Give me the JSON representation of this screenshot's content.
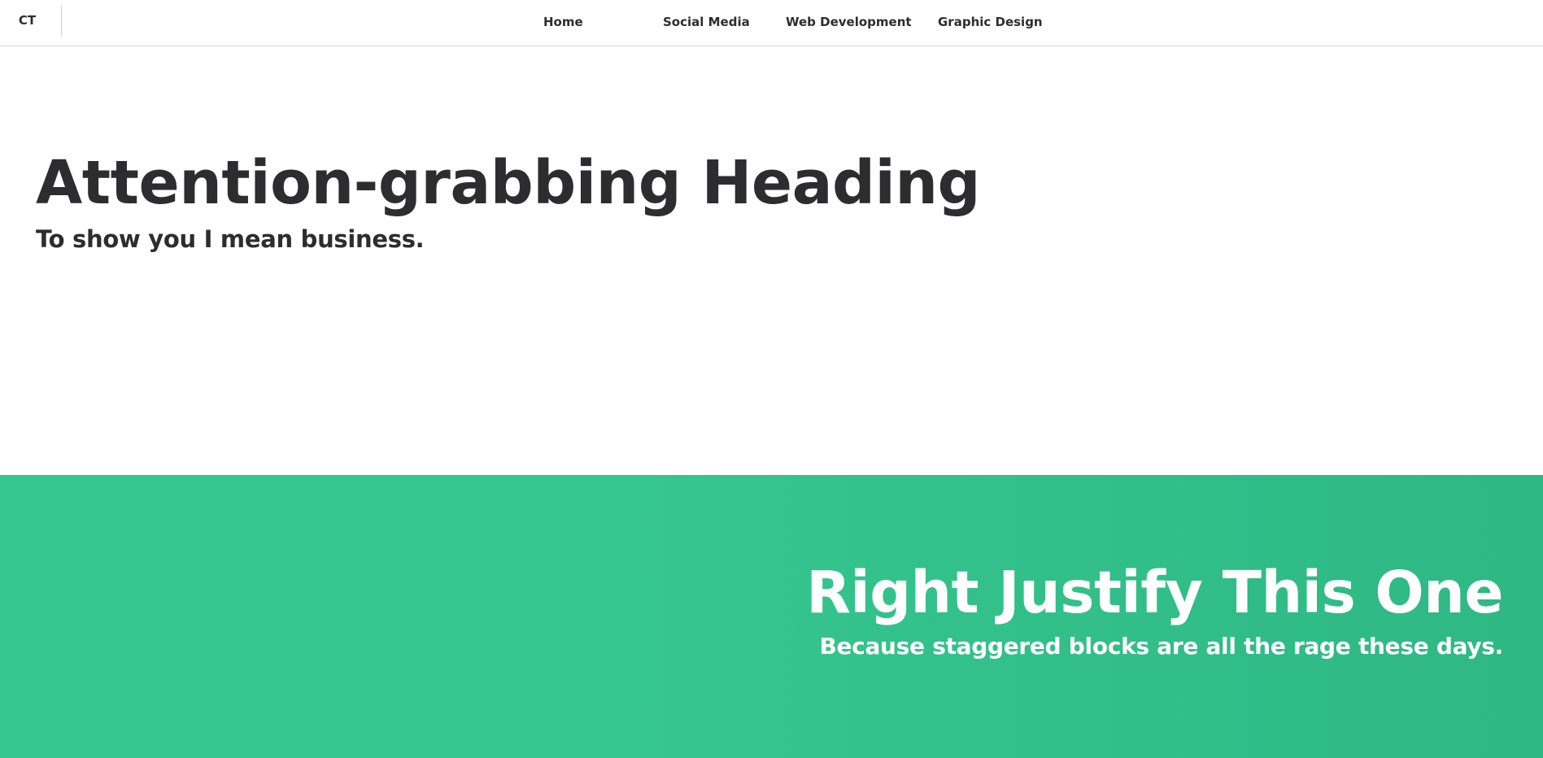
{
  "nav": {
    "brand": "CT",
    "links": [
      {
        "label": "Home"
      },
      {
        "label": "Social Media"
      },
      {
        "label": "Web Development"
      },
      {
        "label": "Graphic Design"
      }
    ]
  },
  "hero": {
    "title": "Attention-grabbing Heading",
    "subtitle": "To show you I mean business."
  },
  "band": {
    "title": "Right Justify This One",
    "subtitle": "Because staggered blocks are all the rage these days.",
    "color": "#36c68f"
  },
  "colors": {
    "text": "#2d2d2f",
    "background": "#ffffff",
    "accent": "#36c68f"
  }
}
